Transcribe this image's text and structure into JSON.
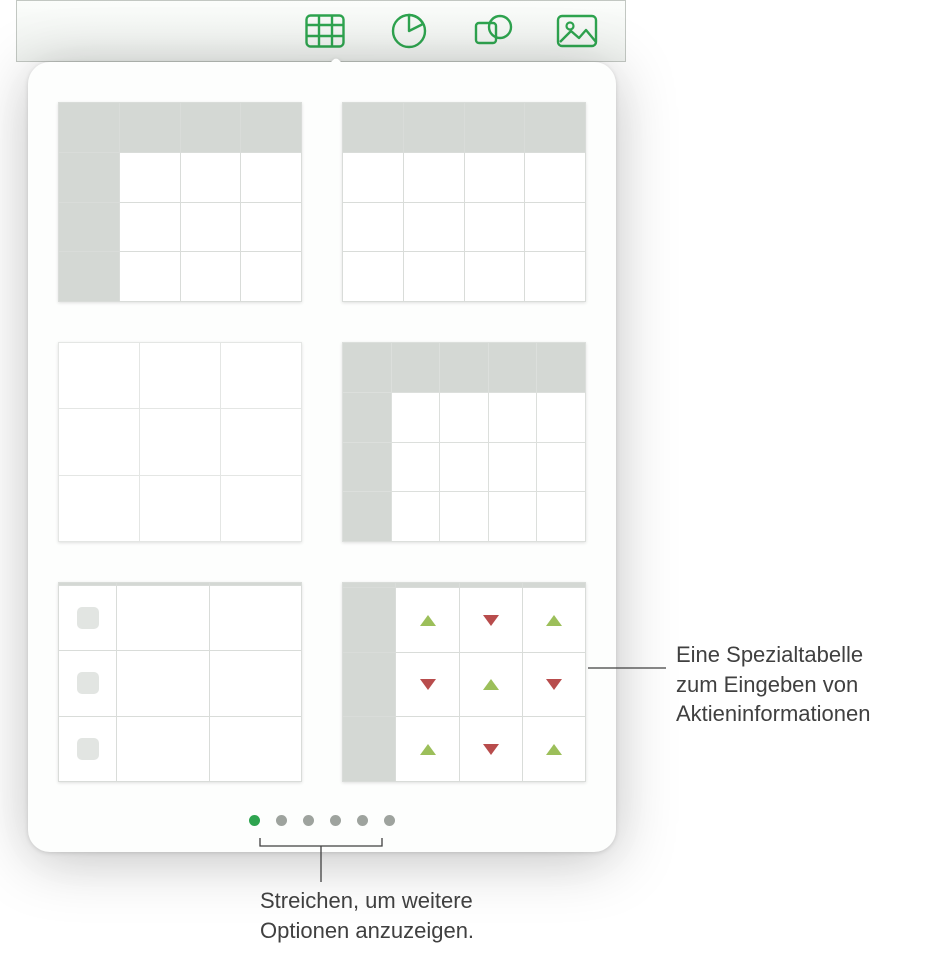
{
  "toolbar": {
    "items": [
      {
        "name": "insert-table-button",
        "icon": "table-icon",
        "active": true
      },
      {
        "name": "insert-chart-button",
        "icon": "piechart-icon",
        "active": false
      },
      {
        "name": "insert-shape-button",
        "icon": "shapes-icon",
        "active": false
      },
      {
        "name": "insert-media-button",
        "icon": "media-icon",
        "active": false
      }
    ],
    "accent_color": "#2ea44f"
  },
  "popover": {
    "styles": [
      {
        "name": "table-style-header-row-col",
        "has_header_row": true,
        "has_header_col": true,
        "body_rows": 3,
        "body_cols": 3
      },
      {
        "name": "table-style-header-row",
        "has_header_row": true,
        "has_header_col": false,
        "body_rows": 3,
        "body_cols": 4
      },
      {
        "name": "table-style-plain",
        "has_header_row": false,
        "has_header_col": false,
        "body_rows": 3,
        "body_cols": 3
      },
      {
        "name": "table-style-header-row-col-grid",
        "has_header_row": true,
        "has_header_col": true,
        "body_rows": 3,
        "body_cols": 4
      },
      {
        "name": "table-style-checklist",
        "has_header_row": true,
        "has_header_col": false,
        "body_rows": 3,
        "body_cols": 3,
        "checkbox_col": 0
      },
      {
        "name": "table-style-stocks",
        "has_header_row": true,
        "has_header_col": true,
        "body_rows": 3,
        "body_cols": 3,
        "stock_arrows": [
          [
            "up",
            "down",
            "up"
          ],
          [
            "down",
            "up",
            "down"
          ],
          [
            "up",
            "down",
            "up"
          ]
        ]
      }
    ],
    "page_dots": {
      "count": 6,
      "active_index": 0
    }
  },
  "callouts": {
    "stocks": "Eine Spezialtabelle\nzum Eingeben von\nAktieninformationen",
    "swipe": "Streichen, um weitere\nOptionen anzuzeigen."
  },
  "colors": {
    "accent": "#2ea44f",
    "header_fill": "#d4d8d4",
    "grid_line": "#d9dcd9",
    "arrow_up": "#9cbf5a",
    "arrow_down": "#b84c4c"
  }
}
